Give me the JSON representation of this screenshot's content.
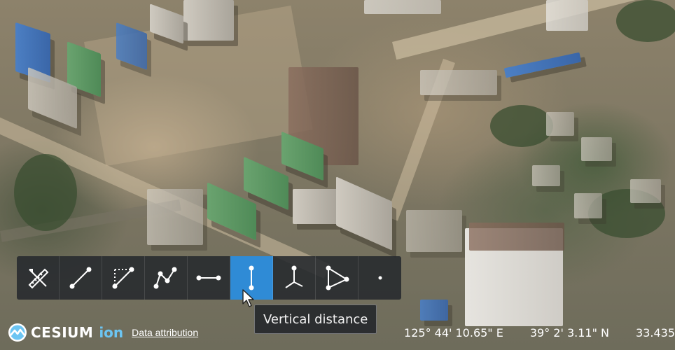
{
  "toolbar": {
    "tools": [
      {
        "icon": "measure-tools-icon",
        "label": "Measure tools"
      },
      {
        "icon": "distance-icon",
        "label": "Distance"
      },
      {
        "icon": "component-distance-icon",
        "label": "Component distance"
      },
      {
        "icon": "polyline-icon",
        "label": "Polyline distance"
      },
      {
        "icon": "horizontal-distance-icon",
        "label": "Horizontal distance"
      },
      {
        "icon": "vertical-distance-icon",
        "label": "Vertical distance",
        "active": true
      },
      {
        "icon": "height-icon",
        "label": "Height from terrain"
      },
      {
        "icon": "area-icon",
        "label": "Area"
      },
      {
        "icon": "point-coordinates-icon",
        "label": "Point coordinates"
      }
    ],
    "active_color": "#2f8bd6"
  },
  "tooltip": {
    "text": "Vertical distance"
  },
  "credit": {
    "logo_text": "CESIUM",
    "logo_suffix": "ion",
    "attribution_link": "Data attribution"
  },
  "coordinates": {
    "longitude": "125° 44' 10.65\" E",
    "latitude": "39° 2' 3.11\" N",
    "height": "33.435"
  }
}
